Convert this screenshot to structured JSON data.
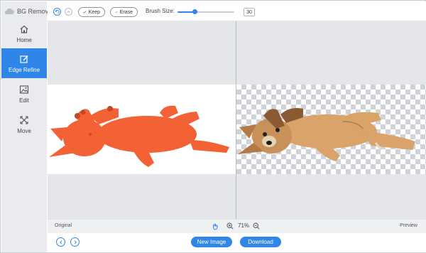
{
  "app": {
    "title": "BG Remover"
  },
  "sidebar": {
    "items": [
      {
        "label": "Home",
        "icon": "home-icon"
      },
      {
        "label": "Edge Refine",
        "icon": "edge-refine-icon",
        "active": true
      },
      {
        "label": "Edit",
        "icon": "image-edit-icon"
      },
      {
        "label": "Move",
        "icon": "move-arrows-icon"
      }
    ]
  },
  "toolbar": {
    "keep_label": "Keep",
    "erase_label": "Erase",
    "brush_size_label": "Brush Size:",
    "brush_size_value": "30",
    "brush_size_fraction": 0.3
  },
  "workspace": {
    "original_label": "Original",
    "preview_label": "Preview",
    "zoom_value": "71%"
  },
  "footer": {
    "new_image_label": "New Image",
    "download_label": "Download"
  },
  "colors": {
    "accent": "#2f86e8",
    "sidebar_bg": "#e9ebee",
    "mask_color": "#f26235",
    "dog_fur": "#d9a36a"
  }
}
